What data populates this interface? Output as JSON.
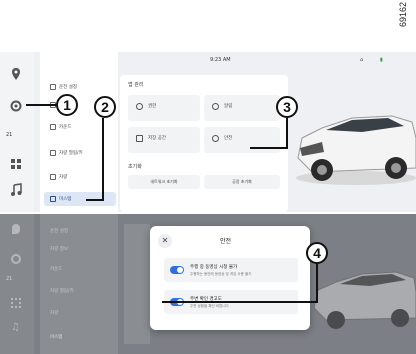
{
  "reference_number": "69162",
  "status_bar": {
    "time": "9:23 AM"
  },
  "rail": {
    "temp_top": "21",
    "temp_bottom": "21"
  },
  "sidebar": {
    "items": [
      {
        "label": "운전 설정"
      },
      {
        "label": "차량 정보"
      },
      {
        "label": "카운드"
      },
      {
        "label": "차량 열림/키"
      },
      {
        "label": "차량"
      },
      {
        "label": "미스템"
      }
    ]
  },
  "content": {
    "section1_title": "앱 관리",
    "tiles": [
      {
        "label": "권한"
      },
      {
        "label": "알림"
      },
      {
        "label": "저장 공간"
      },
      {
        "label": "안전"
      }
    ],
    "section2_title": "초기화",
    "buttons": [
      {
        "label": "네트워크 초기화"
      },
      {
        "label": "공장 초기화"
      }
    ]
  },
  "dialog": {
    "title": "안전",
    "option1": {
      "label": "주행 중 동영상 시청 불가",
      "desc": "주행하는 동안에 동영상 및 게임 사용 불가"
    },
    "option2": {
      "label": "주변 확인 경고도",
      "desc": "주변 상황을 확인 바랍니다"
    }
  },
  "callouts": [
    "1",
    "2",
    "3",
    "4"
  ]
}
